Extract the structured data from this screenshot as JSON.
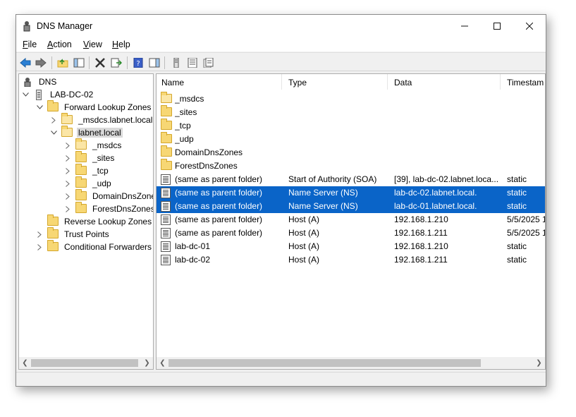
{
  "window": {
    "title": "DNS Manager"
  },
  "menu": [
    "File",
    "Action",
    "View",
    "Help"
  ],
  "tree": [
    {
      "label": "DNS",
      "icon": "dns-icon",
      "expander": "",
      "level": 0
    },
    {
      "label": "LAB-DC-02",
      "icon": "server-icon",
      "expander": "collapse",
      "level": 0
    },
    {
      "label": "Forward Lookup Zones",
      "icon": "folder-icon",
      "expander": "collapse",
      "level": 1
    },
    {
      "label": "_msdcs.labnet.local",
      "icon": "zone-icon",
      "expander": "expand",
      "level": 2
    },
    {
      "label": "labnet.local",
      "icon": "zone-icon",
      "expander": "collapse",
      "level": 2,
      "selected": true
    },
    {
      "label": "_msdcs",
      "icon": "zone-icon",
      "expander": "expand",
      "level": 3
    },
    {
      "label": "_sites",
      "icon": "folder-icon",
      "expander": "expand",
      "level": 3
    },
    {
      "label": "_tcp",
      "icon": "folder-icon",
      "expander": "expand",
      "level": 3
    },
    {
      "label": "_udp",
      "icon": "folder-icon",
      "expander": "expand",
      "level": 3
    },
    {
      "label": "DomainDnsZones",
      "icon": "folder-icon",
      "expander": "expand",
      "level": 3
    },
    {
      "label": "ForestDnsZones",
      "icon": "folder-icon",
      "expander": "expand",
      "level": 3
    },
    {
      "label": "Reverse Lookup Zones",
      "icon": "folder-icon",
      "expander": "",
      "level": 1
    },
    {
      "label": "Trust Points",
      "icon": "folder-icon",
      "expander": "expand",
      "level": 1
    },
    {
      "label": "Conditional Forwarders",
      "icon": "folder-icon",
      "expander": "expand",
      "level": 1
    }
  ],
  "list": {
    "columns": [
      "Name",
      "Type",
      "Data",
      "Timestam"
    ],
    "rows": [
      {
        "icon": "zone-icon",
        "name": "_msdcs",
        "type": "",
        "data": "",
        "timestamp": ""
      },
      {
        "icon": "folder-icon",
        "name": "_sites",
        "type": "",
        "data": "",
        "timestamp": ""
      },
      {
        "icon": "folder-icon",
        "name": "_tcp",
        "type": "",
        "data": "",
        "timestamp": ""
      },
      {
        "icon": "folder-icon",
        "name": "_udp",
        "type": "",
        "data": "",
        "timestamp": ""
      },
      {
        "icon": "folder-icon",
        "name": "DomainDnsZones",
        "type": "",
        "data": "",
        "timestamp": ""
      },
      {
        "icon": "folder-icon",
        "name": "ForestDnsZones",
        "type": "",
        "data": "",
        "timestamp": ""
      },
      {
        "icon": "record-icon",
        "name": "(same as parent folder)",
        "type": "Start of Authority (SOA)",
        "data": "[39], lab-dc-02.labnet.loca...",
        "timestamp": "static"
      },
      {
        "icon": "record-icon",
        "name": "(same as parent folder)",
        "type": "Name Server (NS)",
        "data": "lab-dc-02.labnet.local.",
        "timestamp": "static",
        "selected": true
      },
      {
        "icon": "record-icon",
        "name": "(same as parent folder)",
        "type": "Name Server (NS)",
        "data": "lab-dc-01.labnet.local.",
        "timestamp": "static",
        "selected": true
      },
      {
        "icon": "record-icon",
        "name": "(same as parent folder)",
        "type": "Host (A)",
        "data": "192.168.1.210",
        "timestamp": "5/5/2025 1"
      },
      {
        "icon": "record-icon",
        "name": "(same as parent folder)",
        "type": "Host (A)",
        "data": "192.168.1.211",
        "timestamp": "5/5/2025 1"
      },
      {
        "icon": "record-icon",
        "name": "lab-dc-01",
        "type": "Host (A)",
        "data": "192.168.1.210",
        "timestamp": "static"
      },
      {
        "icon": "record-icon",
        "name": "lab-dc-02",
        "type": "Host (A)",
        "data": "192.168.1.211",
        "timestamp": "static"
      }
    ]
  },
  "colors": {
    "selection": "#0a64c8",
    "tree_selection": "#d9d9d9",
    "window_bg": "#f0f0f0"
  }
}
